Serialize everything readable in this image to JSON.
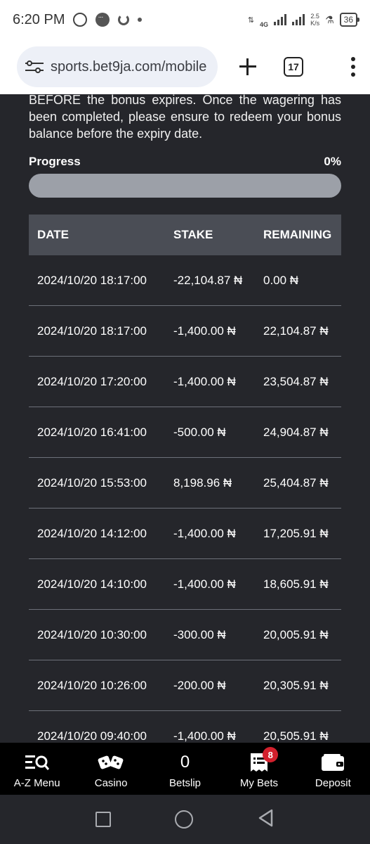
{
  "status_bar": {
    "time": "6:20 PM",
    "network": "4G",
    "speed_value": "2.5",
    "speed_unit": "K/s",
    "battery": "36"
  },
  "browser": {
    "url": "sports.bet9ja.com/mobile",
    "tab_count": "17"
  },
  "bonus": {
    "text": "BEFORE the bonus expires. Once the wagering has been completed, please ensure to redeem your bonus balance before the expiry date.",
    "progress_label": "Progress",
    "progress_value": "0%",
    "progress_fraction": 0
  },
  "table": {
    "headers": [
      "DATE",
      "STAKE",
      "REMAINING"
    ],
    "rows": [
      {
        "date": "2024/10/20 18:17:00",
        "stake": "-22,104.87 ₦",
        "remaining": "0.00 ₦"
      },
      {
        "date": "2024/10/20 18:17:00",
        "stake": "-1,400.00 ₦",
        "remaining": "22,104.87 ₦"
      },
      {
        "date": "2024/10/20 17:20:00",
        "stake": "-1,400.00 ₦",
        "remaining": "23,504.87 ₦"
      },
      {
        "date": "2024/10/20 16:41:00",
        "stake": "-500.00 ₦",
        "remaining": "24,904.87 ₦"
      },
      {
        "date": "2024/10/20 15:53:00",
        "stake": "8,198.96 ₦",
        "remaining": "25,404.87 ₦"
      },
      {
        "date": "2024/10/20 14:12:00",
        "stake": "-1,400.00 ₦",
        "remaining": "17,205.91 ₦"
      },
      {
        "date": "2024/10/20 14:10:00",
        "stake": "-1,400.00 ₦",
        "remaining": "18,605.91 ₦"
      },
      {
        "date": "2024/10/20 10:30:00",
        "stake": "-300.00 ₦",
        "remaining": "20,005.91 ₦"
      },
      {
        "date": "2024/10/20 10:26:00",
        "stake": "-200.00 ₦",
        "remaining": "20,305.91 ₦"
      },
      {
        "date": "2024/10/20 09:40:00",
        "stake": "-1,400.00 ₦",
        "remaining": "20,505.91 ₦"
      }
    ]
  },
  "bottom_nav": {
    "az_menu": "A-Z Menu",
    "casino": "Casino",
    "betslip": "Betslip",
    "betslip_count": "0",
    "my_bets": "My Bets",
    "my_bets_badge": "8",
    "deposit": "Deposit"
  }
}
